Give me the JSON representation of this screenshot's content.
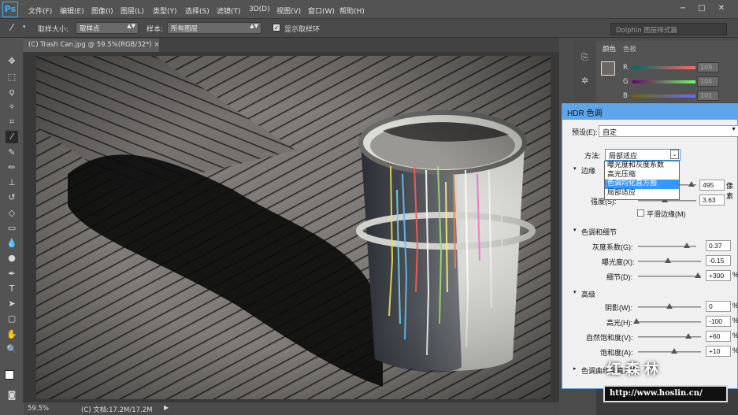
{
  "app": {
    "logo": "Ps"
  },
  "menu": [
    "文件(F)",
    "编辑(E)",
    "图像(I)",
    "图层(L)",
    "类型(Y)",
    "选择(S)",
    "滤镜(T)",
    "3D(D)",
    "视图(V)",
    "窗口(W)",
    "帮助(H)"
  ],
  "window_controls": {
    "minimize": "−",
    "maximize": "□",
    "close": "✕"
  },
  "options": {
    "sample_size_label": "取样大小:",
    "sample_size_value": "取样点",
    "sample_label": "样本:",
    "sample_value": "所有图层",
    "show_ring_label": "显示取样环"
  },
  "workspace": "Dolphin 图层样式篇",
  "doc_tab": "(C) Trash Can.jpg @ 59.5%(RGB/32*)  ×",
  "status": {
    "zoom": "59.5%",
    "doc": "(C) 文档:17.2M/17.2M"
  },
  "color_panel": {
    "tabs": [
      "颜色",
      "色板"
    ],
    "r_label": "R",
    "r_value": "109",
    "g_label": "G",
    "g_value": "104",
    "b_label": "B",
    "b_value": "101"
  },
  "hdr": {
    "title": "HDR 色调",
    "preset_label": "预设(E):",
    "preset_value": "自定",
    "method_label": "方法:",
    "method_value": "局部适应",
    "methods": [
      "曝光度和灰度系数",
      "高光压缩",
      "色调均化直方图",
      "局部适应"
    ],
    "selected_method_index": 2,
    "edge_group": "边缘",
    "radius_value": "495",
    "radius_unit": "像素",
    "strength_label": "强度(S):",
    "strength_value": "3.63",
    "smooth_edges_label": "平滑边缘(M)",
    "tone_group": "色调和细节",
    "gamma_label": "灰度系数(G):",
    "gamma_value": "0.37",
    "exposure_label": "曝光度(X):",
    "exposure_value": "-0.15",
    "detail_label": "细节(D):",
    "detail_value": "+300",
    "detail_unit": "%",
    "advanced_group": "高级",
    "shadow_label": "阴影(W):",
    "shadow_value": "0",
    "shadow_unit": "%",
    "highlight_label": "高光(H):",
    "highlight_value": "-100",
    "highlight_unit": "%",
    "vibrance_label": "自然饱和度(V):",
    "vibrance_value": "+60",
    "vibrance_unit": "%",
    "saturation_label": "饱和度(A):",
    "saturation_value": "+10",
    "saturation_unit": "%",
    "curve_group": "色调曲线和直方图"
  },
  "watermark": {
    "url": "http://www.hoslin.cn/",
    "name": "红森林"
  }
}
